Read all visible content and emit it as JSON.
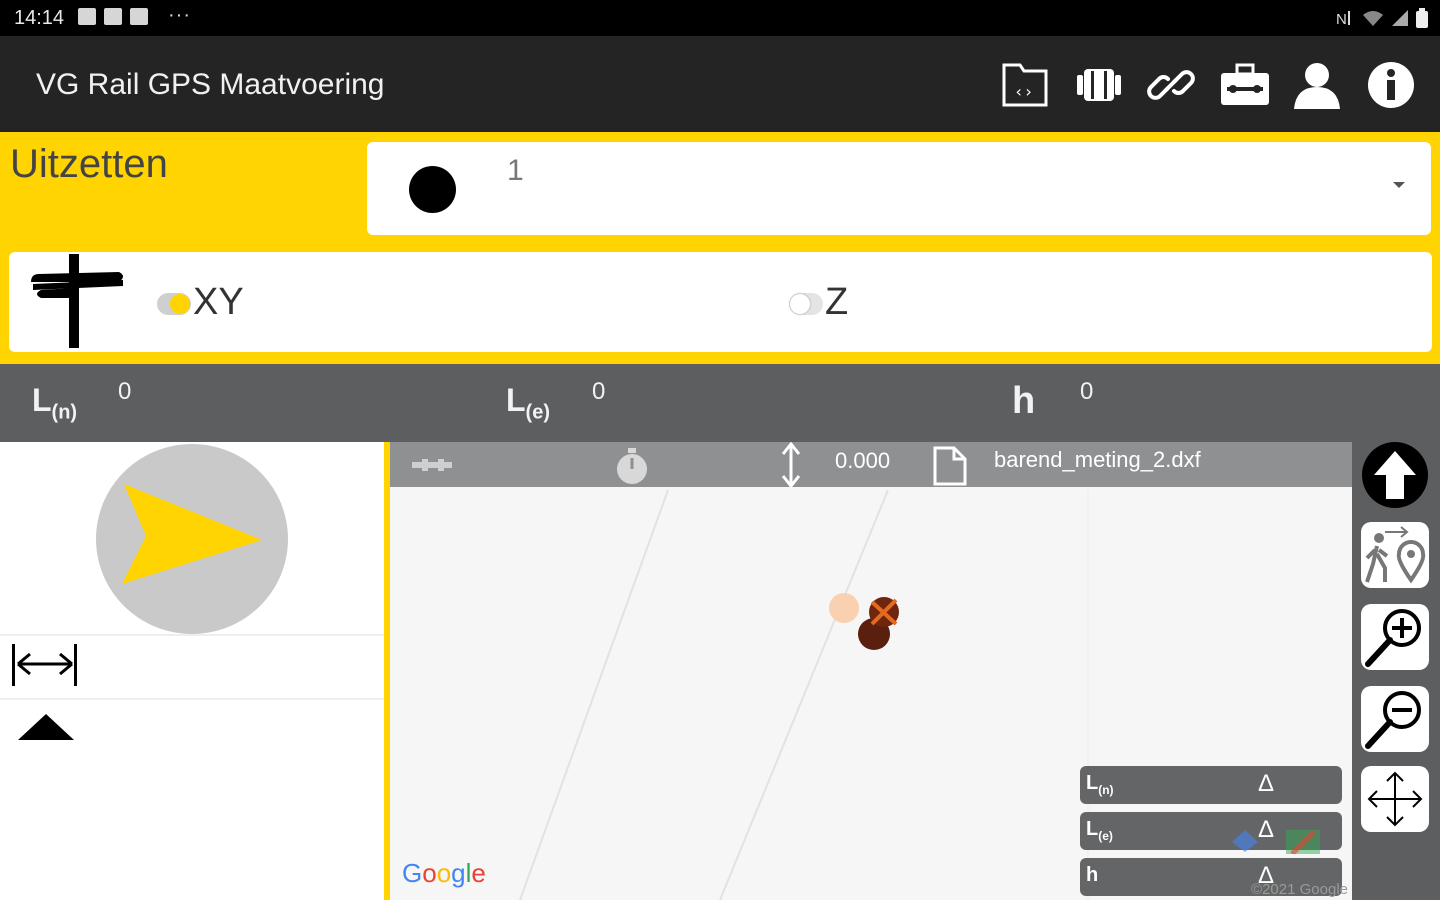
{
  "status_bar": {
    "time": "14:14",
    "more": "···"
  },
  "app_bar": {
    "title": "VG Rail GPS Maatvoering",
    "icons": [
      "folder-code-icon",
      "device-icon",
      "link-icon",
      "toolbox-icon",
      "user-icon",
      "info-icon"
    ]
  },
  "stakeout": {
    "title": "Uitzetten",
    "point_selector": {
      "value": "1"
    },
    "modes": [
      {
        "label": "XY",
        "on": true
      },
      {
        "label": "Z",
        "on": false
      }
    ]
  },
  "readout": {
    "ln": {
      "label": "L",
      "sub": "(n)",
      "value": "0"
    },
    "le": {
      "label": "L",
      "sub": "(e)",
      "value": "0"
    },
    "h": {
      "label": "h",
      "value": "0"
    }
  },
  "map": {
    "elevation": "0.000",
    "filename": "barend_meting_2.dxf",
    "google": [
      "G",
      "o",
      "o",
      "g",
      "l",
      "e"
    ],
    "copyright": "©2021 Google",
    "delta_rows": [
      {
        "label": "L",
        "sub": "(n)",
        "delta": "Δ"
      },
      {
        "label": "L",
        "sub": "(e)",
        "delta": "Δ"
      },
      {
        "label": "h",
        "sub": "",
        "delta": "Δ"
      }
    ]
  },
  "colors": {
    "accent": "#FFD400",
    "appbar": "#242424",
    "panel": "#5C5E60"
  }
}
